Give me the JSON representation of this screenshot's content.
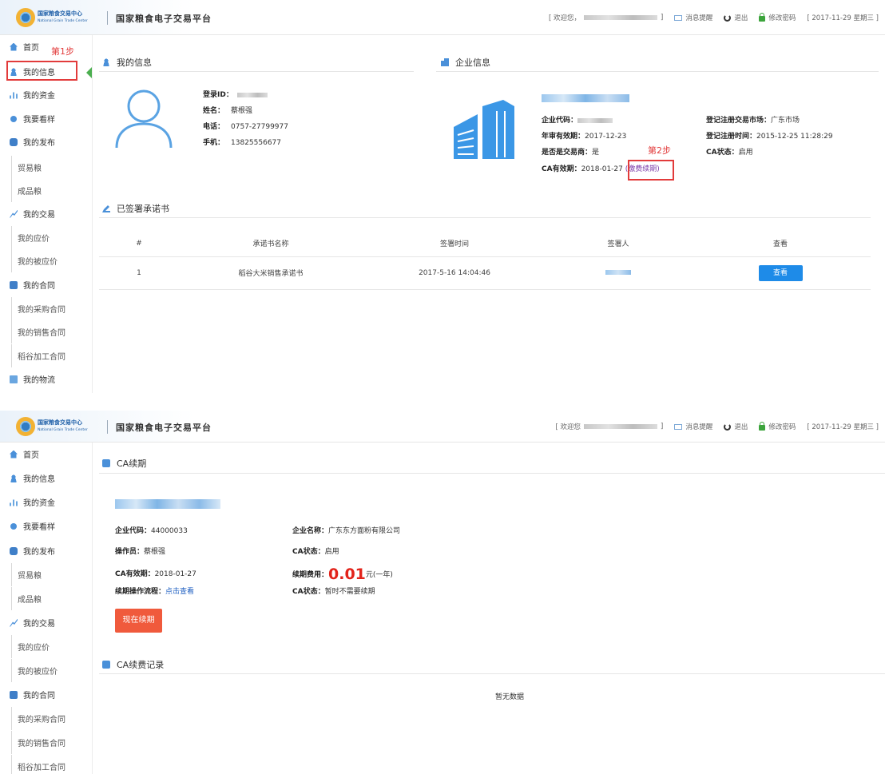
{
  "header": {
    "logo_cn": "国家粮食交易中心",
    "logo_en": "National Grain Trade Center",
    "platform_title": "国家粮食电子交易平台",
    "welcome_1": "[ 欢迎您，",
    "welcome_2": "[ 欢迎您",
    "welcome_close": "]",
    "msg_label": "消息提醒",
    "logout_label": "退出",
    "password_label": "修改密码",
    "date": "[ 2017-11-29 星期三 ]"
  },
  "sidebar": {
    "items": [
      {
        "label": "首页",
        "icon": "home-icon"
      },
      {
        "label": "我的信息",
        "icon": "user-icon"
      },
      {
        "label": "我的资金",
        "icon": "bar-chart-icon"
      },
      {
        "label": "我要看样",
        "icon": "sample-icon"
      },
      {
        "label": "我的发布",
        "icon": "publish-icon"
      },
      {
        "label": "贸易粮",
        "sub": true
      },
      {
        "label": "成品粮",
        "sub": true
      },
      {
        "label": "我的交易",
        "icon": "trade-icon"
      },
      {
        "label": "我的应价",
        "sub": true
      },
      {
        "label": "我的被应价",
        "sub": true
      },
      {
        "label": "我的合同",
        "icon": "contract-icon"
      },
      {
        "label": "我的采购合同",
        "sub": true
      },
      {
        "label": "我的销售合同",
        "sub": true
      },
      {
        "label": "稻谷加工合同",
        "sub": true
      },
      {
        "label": "我的物流",
        "icon": "logistics-icon"
      }
    ]
  },
  "annotations": {
    "step1": "第1步",
    "step2": "第2步"
  },
  "my_info": {
    "title": "我的信息",
    "login_id_label": "登录ID：",
    "name_label": "姓名：",
    "name_value": "蔡根强",
    "phone_label": "电话：",
    "phone_value": "0757-27799977",
    "mobile_label": "手机：",
    "mobile_value": "13825556677"
  },
  "company_info": {
    "title": "企业信息",
    "code_label": "企业代码：",
    "audit_label": "年审有效期：",
    "audit_value": "2017-12-23",
    "is_trader_label": "是否是交易商：",
    "is_trader_value": "是",
    "ca_valid_label": "CA有效期：",
    "ca_valid_value": "2018-01-27",
    "renew_link": "(缴费续期)",
    "market_label": "登记注册交易市场：",
    "market_value": "广东市场",
    "reg_time_label": "登记注册时间：",
    "reg_time_value": "2015-12-25 11:28:29",
    "ca_status_label": "CA状态：",
    "ca_status_value": "启用"
  },
  "promise": {
    "title": "已签署承诺书",
    "columns": [
      "#",
      "承诺书名称",
      "签署时间",
      "签署人",
      "查看"
    ],
    "rows": [
      {
        "index": "1",
        "name": "稻谷大米销售承诺书",
        "time": "2017-5-16 14:04:46",
        "view": "查看"
      }
    ]
  },
  "ca_renew": {
    "title": "CA续期",
    "code_label": "企业代码：",
    "code_value": "44000033",
    "company_label": "企业名称：",
    "company_value": "广东东方面粉有限公司",
    "operator_label": "操作员：",
    "operator_value": "蔡根强",
    "status_label": "CA状态：",
    "status_value": "启用",
    "valid_label": "CA有效期：",
    "valid_value": "2018-01-27",
    "fee_label": "续期费用：",
    "fee_value": "0.01",
    "fee_unit": "元(一年)",
    "flow_label": "续期操作流程：",
    "flow_link": "点击查看",
    "status2_label": "CA状态：",
    "status2_value": "暂时不需要续期",
    "button": "现在续期"
  },
  "ca_records": {
    "title": "CA续费记录",
    "empty": "暂无数据"
  },
  "colors": {
    "accent": "#1e8be8",
    "annotation_red": "#e23b3b",
    "renew_button": "#f05a3c",
    "fee_red": "#e2231a"
  }
}
